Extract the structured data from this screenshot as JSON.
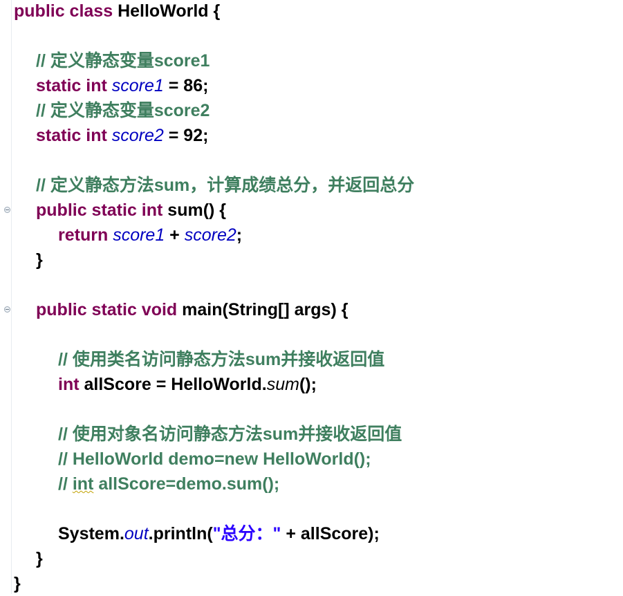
{
  "colors": {
    "keyword": "#7f0055",
    "comment": "#3f7f5f",
    "field": "#0000c0",
    "string": "#2a00ff"
  },
  "lines": [
    {
      "indent": 0,
      "tokens": [
        [
          "kw",
          "public class "
        ],
        [
          "tx",
          "HelloWorld {"
        ]
      ]
    },
    {
      "indent": 0,
      "tokens": []
    },
    {
      "indent": 1,
      "tokens": [
        [
          "cm",
          "// 定义静态变量score1"
        ]
      ]
    },
    {
      "indent": 1,
      "tokens": [
        [
          "kw",
          "static int "
        ],
        [
          "fd",
          "score1"
        ],
        [
          "tx",
          " = 86;"
        ]
      ]
    },
    {
      "indent": 1,
      "tokens": [
        [
          "cm",
          "// 定义静态变量score2"
        ]
      ]
    },
    {
      "indent": 1,
      "tokens": [
        [
          "kw",
          "static int "
        ],
        [
          "fd",
          "score2"
        ],
        [
          "tx",
          " = 92;"
        ]
      ]
    },
    {
      "indent": 0,
      "tokens": []
    },
    {
      "indent": 1,
      "tokens": [
        [
          "cm",
          "// 定义静态方法sum，计算成绩总分，并返回总分"
        ]
      ]
    },
    {
      "indent": 1,
      "fold": true,
      "tokens": [
        [
          "kw",
          "public static int "
        ],
        [
          "tx",
          "sum() {"
        ]
      ]
    },
    {
      "indent": 2,
      "tokens": [
        [
          "kw",
          "return "
        ],
        [
          "fd",
          "score1"
        ],
        [
          "tx",
          " + "
        ],
        [
          "fd",
          "score2"
        ],
        [
          "tx",
          ";"
        ]
      ]
    },
    {
      "indent": 1,
      "tokens": [
        [
          "tx",
          "}"
        ]
      ]
    },
    {
      "indent": 0,
      "tokens": []
    },
    {
      "indent": 1,
      "fold": true,
      "tokens": [
        [
          "kw",
          "public static void "
        ],
        [
          "tx",
          "main(String[] args) {"
        ]
      ]
    },
    {
      "indent": 0,
      "tokens": []
    },
    {
      "indent": 2,
      "tokens": [
        [
          "cm",
          "// 使用类名访问静态方法sum并接收返回值"
        ]
      ]
    },
    {
      "indent": 2,
      "tokens": [
        [
          "kw",
          "int "
        ],
        [
          "tx",
          "allScore = HelloWorld."
        ],
        [
          "im",
          "sum"
        ],
        [
          "tx",
          "();"
        ]
      ]
    },
    {
      "indent": 0,
      "tokens": []
    },
    {
      "indent": 2,
      "tokens": [
        [
          "cm",
          "// 使用对象名访问静态方法sum并接收返回值"
        ]
      ]
    },
    {
      "indent": 2,
      "tokens": [
        [
          "cm",
          "// HelloWorld demo=new HelloWorld();"
        ]
      ]
    },
    {
      "indent": 2,
      "tokens": [
        [
          "cm",
          "// "
        ],
        [
          "cmsq",
          "int"
        ],
        [
          "cm",
          " allScore=demo.sum();"
        ]
      ]
    },
    {
      "indent": 0,
      "tokens": []
    },
    {
      "indent": 2,
      "tokens": [
        [
          "tx",
          "System."
        ],
        [
          "fd",
          "out"
        ],
        [
          "tx",
          ".println("
        ],
        [
          "st",
          "\"总分：\""
        ],
        [
          "tx",
          " + allScore);"
        ]
      ]
    },
    {
      "indent": 1,
      "tokens": [
        [
          "tx",
          "}"
        ]
      ]
    },
    {
      "indent": 0,
      "tokens": [
        [
          "tx",
          "}"
        ]
      ]
    }
  ]
}
